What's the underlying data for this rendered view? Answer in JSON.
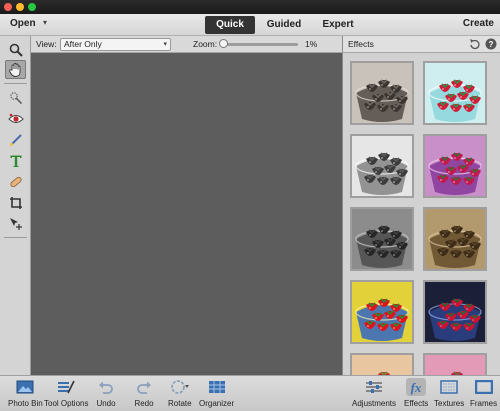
{
  "topbar": {
    "open_label": "Open",
    "modes": [
      {
        "label": "Quick",
        "active": true
      },
      {
        "label": "Guided",
        "active": false
      },
      {
        "label": "Expert",
        "active": false
      }
    ],
    "create_label": "Create"
  },
  "toolbox": {
    "tools": [
      {
        "name": "zoom-tool",
        "icon": "magnifier-icon",
        "selected": false
      },
      {
        "name": "hand-tool",
        "icon": "hand-icon",
        "selected": true
      },
      {
        "name": "quick-selection-tool",
        "icon": "quick-selection-icon",
        "selected": false
      },
      {
        "name": "red-eye-tool",
        "icon": "eye-icon",
        "selected": false
      },
      {
        "name": "whiten-teeth-tool",
        "icon": "brush-icon",
        "selected": false
      },
      {
        "name": "type-tool",
        "icon": "text-icon",
        "selected": false
      },
      {
        "name": "spot-healing-tool",
        "icon": "bandage-icon",
        "selected": false
      },
      {
        "name": "crop-tool",
        "icon": "crop-icon",
        "selected": false
      },
      {
        "name": "move-tool",
        "icon": "move-icon",
        "selected": false
      }
    ]
  },
  "options": {
    "view_label": "View:",
    "view_value": "After Only",
    "zoom_label": "Zoom:",
    "zoom_value": "1%",
    "zoom_level": 0.01
  },
  "panel": {
    "title": "Effects",
    "effects": [
      {
        "name": "effect-sepia-dark",
        "tone": "sepia"
      },
      {
        "name": "effect-cyan-pop",
        "tone": "cyan"
      },
      {
        "name": "effect-bw-light",
        "tone": "bw-light"
      },
      {
        "name": "effect-purple",
        "tone": "purple"
      },
      {
        "name": "effect-bw-dark",
        "tone": "bw-dark"
      },
      {
        "name": "effect-brown-tint",
        "tone": "brown"
      },
      {
        "name": "effect-vivid-yellow",
        "tone": "vivid"
      },
      {
        "name": "effect-cross-process",
        "tone": "cross"
      },
      {
        "name": "effect-warm-partial",
        "tone": "warm"
      },
      {
        "name": "effect-pink-partial",
        "tone": "pink"
      }
    ]
  },
  "bottombar": {
    "items": [
      {
        "name": "photo-bin-button",
        "label": "Photo Bin",
        "icon": "photo-bin-icon"
      },
      {
        "name": "tool-options-button",
        "label": "Tool Options",
        "icon": "tool-options-icon"
      },
      {
        "name": "undo-button",
        "label": "Undo",
        "icon": "undo-icon"
      },
      {
        "name": "redo-button",
        "label": "Redo",
        "icon": "redo-icon"
      },
      {
        "name": "rotate-button",
        "label": "Rotate",
        "icon": "rotate-icon"
      },
      {
        "name": "organizer-button",
        "label": "Organizer",
        "icon": "organizer-icon"
      },
      {
        "name": "adjustments-button",
        "label": "Adjustments",
        "icon": "adjustments-icon"
      },
      {
        "name": "effects-button",
        "label": "Effects",
        "icon": "fx-icon",
        "active": true
      },
      {
        "name": "textures-button",
        "label": "Textures",
        "icon": "textures-icon"
      },
      {
        "name": "frames-button",
        "label": "Frames",
        "icon": "frames-icon"
      }
    ]
  }
}
